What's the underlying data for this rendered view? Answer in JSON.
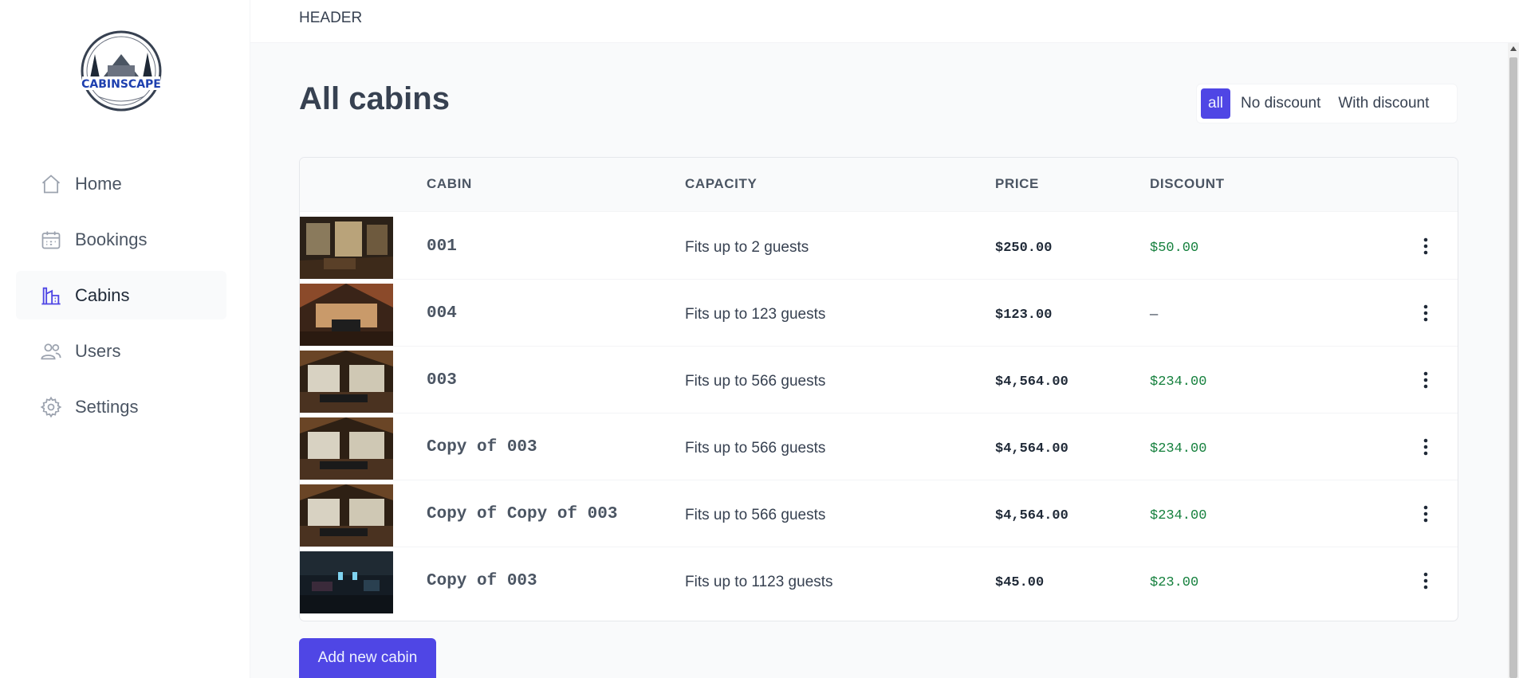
{
  "header": {
    "text": "HEADER"
  },
  "logo": {
    "text": "CABINSCAPE"
  },
  "sidebar": {
    "items": [
      {
        "label": "Home",
        "icon": "home-icon"
      },
      {
        "label": "Bookings",
        "icon": "calendar-icon"
      },
      {
        "label": "Cabins",
        "icon": "buildings-icon",
        "active": true
      },
      {
        "label": "Users",
        "icon": "users-icon"
      },
      {
        "label": "Settings",
        "icon": "gear-icon"
      }
    ]
  },
  "page": {
    "title": "All cabins"
  },
  "filter": {
    "options": [
      "all",
      "No discount",
      "With discount"
    ],
    "selected": "all"
  },
  "table": {
    "columns": [
      "",
      "CABIN",
      "CAPACITY",
      "PRICE",
      "DISCOUNT",
      ""
    ],
    "rows": [
      {
        "name": "001",
        "capacity": "Fits up to 2 guests",
        "price": "$250.00",
        "discount": "$50.00"
      },
      {
        "name": "004",
        "capacity": "Fits up to 123 guests",
        "price": "$123.00",
        "discount": "—"
      },
      {
        "name": "003",
        "capacity": "Fits up to 566 guests",
        "price": "$4,564.00",
        "discount": "$234.00"
      },
      {
        "name": "Copy of 003",
        "capacity": "Fits up to 566 guests",
        "price": "$4,564.00",
        "discount": "$234.00"
      },
      {
        "name": "Copy of Copy of 003",
        "capacity": "Fits up to 566 guests",
        "price": "$4,564.00",
        "discount": "$234.00"
      },
      {
        "name": "Copy of 003",
        "capacity": "Fits up to 1123 guests",
        "price": "$45.00",
        "discount": "$23.00"
      }
    ]
  },
  "actions": {
    "add_label": "Add new cabin"
  },
  "colors": {
    "accent": "#4f46e5",
    "discount": "#15803d",
    "text": "#374151",
    "background": "#f9fafb"
  }
}
